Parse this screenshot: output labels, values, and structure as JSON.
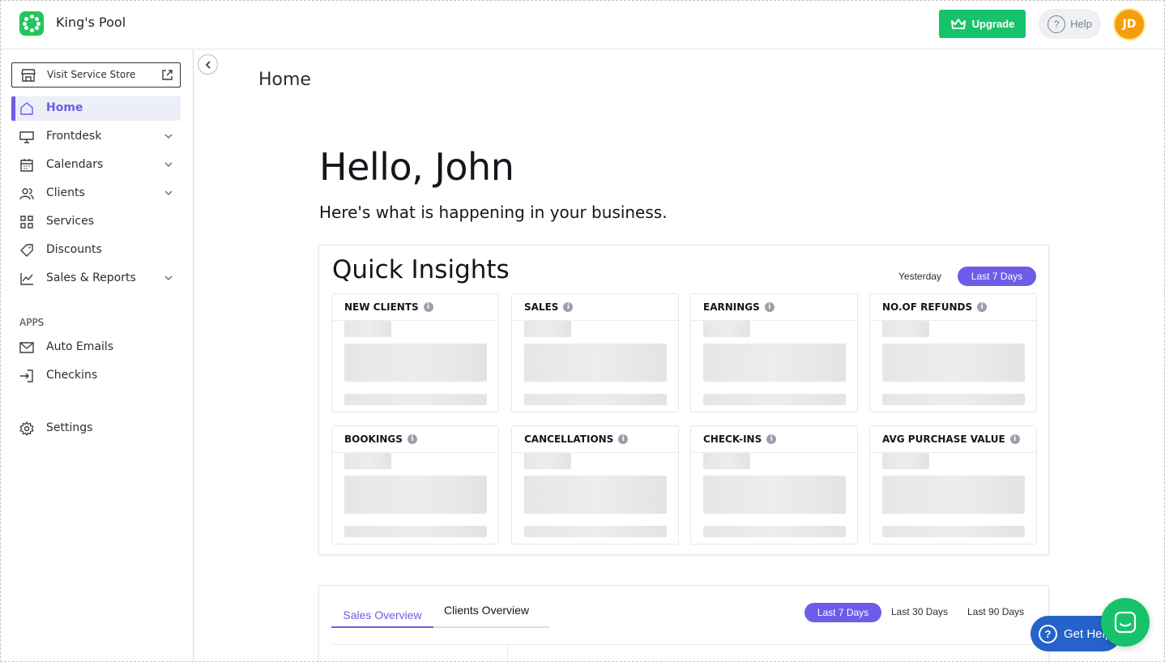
{
  "app": {
    "brand": "King's Pool",
    "upgrade_label": "Upgrade",
    "help_label": "Help",
    "avatar_initials": "JD"
  },
  "colors": {
    "accent": "#6d5ce8",
    "brand_green": "#16c36a",
    "avatar": "#f59e0b",
    "help_widget": "#2563c9"
  },
  "sidebar": {
    "visit_store": "Visit Service Store",
    "items": [
      {
        "label": "Home",
        "icon": "home-icon"
      },
      {
        "label": "Frontdesk",
        "icon": "monitor-icon"
      },
      {
        "label": "Calendars",
        "icon": "calendar-icon"
      },
      {
        "label": "Clients",
        "icon": "users-icon"
      },
      {
        "label": "Services",
        "icon": "grid-icon"
      },
      {
        "label": "Discounts",
        "icon": "tag-icon"
      },
      {
        "label": "Sales & Reports",
        "icon": "chart-icon"
      }
    ],
    "apps_heading": "APPS",
    "apps": [
      {
        "label": "Auto Emails",
        "icon": "mail-icon"
      },
      {
        "label": "Checkins",
        "icon": "login-icon"
      }
    ],
    "settings": "Settings"
  },
  "main": {
    "page_title": "Home",
    "greeting": "Hello, John",
    "subgreeting": "Here's what is happening in your business."
  },
  "insights": {
    "title": "Quick Insights",
    "filters": [
      "Yesterday",
      "Last 7 Days"
    ],
    "cards": [
      "NEW CLIENTS",
      "SALES",
      "EARNINGS",
      "NO.OF REFUNDS",
      "BOOKINGS",
      "CANCELLATIONS",
      "CHECK-INS",
      "AVG PURCHASE VALUE"
    ]
  },
  "overview": {
    "tabs": [
      "Sales Overview",
      "Clients Overview"
    ],
    "filters": [
      "Last 7 Days",
      "Last 30 Days",
      "Last 90 Days"
    ]
  },
  "widgets": {
    "get_help": "Get Help"
  }
}
